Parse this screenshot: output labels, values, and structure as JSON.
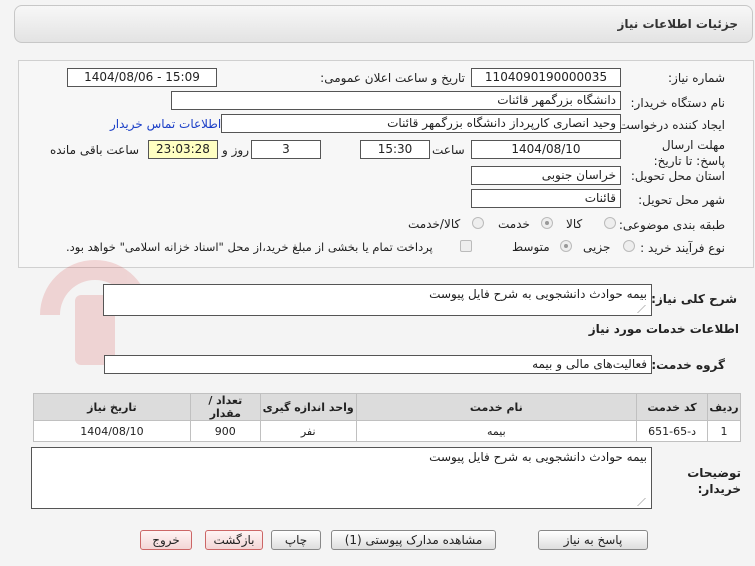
{
  "header": {
    "title": "جزئیات اطلاعات نیاز"
  },
  "form": {
    "need_number_label": "شماره نیاز:",
    "need_number": "1104090190000035",
    "announce_label": "تاریخ و ساعت اعلان عمومی:",
    "announce_value": "1404/08/06 - 15:09",
    "buyer_org_label": "نام دستگاه خریدار:",
    "buyer_org": "دانشگاه بزرگمهر قائنات",
    "requester_label": "ایجاد کننده درخواست:",
    "requester": "وحید انصاری کارپرداز دانشگاه بزرگمهر قائنات",
    "contact_link": "اطلاعات تماس خریدار",
    "deadline_label": "مهلت ارسال پاسخ: تا تاریخ:",
    "deadline_date": "1404/08/10",
    "time_label": "ساعت",
    "deadline_time": "15:30",
    "days_value": "3",
    "days_label": "روز و",
    "remaining_time": "23:03:28",
    "remaining_label": "ساعت باقی مانده",
    "province_label": "استان محل تحویل:",
    "province": "خراسان جنوبی",
    "city_label": "شهر محل تحویل:",
    "city": "قائنات",
    "category_label": "طبقه بندی موضوعی:",
    "category_options": [
      "کالا",
      "خدمت",
      "کالا/خدمت"
    ],
    "process_label": "نوع فرآیند خرید :",
    "process_options": [
      "جزیی",
      "متوسط"
    ],
    "payment_note": "پرداخت تمام یا بخشی از مبلغ خرید،از محل \"اسناد خزانه اسلامی\" خواهد بود."
  },
  "summary": {
    "label": "شرح کلی نیاز:",
    "value": "بیمه حوادث دانشجویی به شرح فایل پیوست"
  },
  "services": {
    "section_title": "اطلاعات خدمات مورد نیاز",
    "group_label": "گروه خدمت:",
    "group_value": "فعالیت‌های مالی و بیمه",
    "columns": [
      "ردیف",
      "کد خدمت",
      "نام خدمت",
      "واحد اندازه گیری",
      "تعداد / مقدار",
      "تاریخ نیاز"
    ],
    "rows": [
      [
        "1",
        "د-65-651",
        "بیمه",
        "نفر",
        "900",
        "1404/08/10"
      ]
    ]
  },
  "buyer_notes": {
    "label": "توضیحات خریدار:",
    "value": "بیمه حوادث دانشجویی به شرح فایل پیوست"
  },
  "buttons": {
    "reply": "پاسخ به نیاز",
    "view_docs": "مشاهده مدارک پیوستی (1)",
    "print": "چاپ",
    "back": "بازگشت",
    "exit": "خروج"
  },
  "colors": {
    "link": "#1a3ec7",
    "remaining_bg": "#ffffc2",
    "button_red_border": "#cc6666"
  }
}
